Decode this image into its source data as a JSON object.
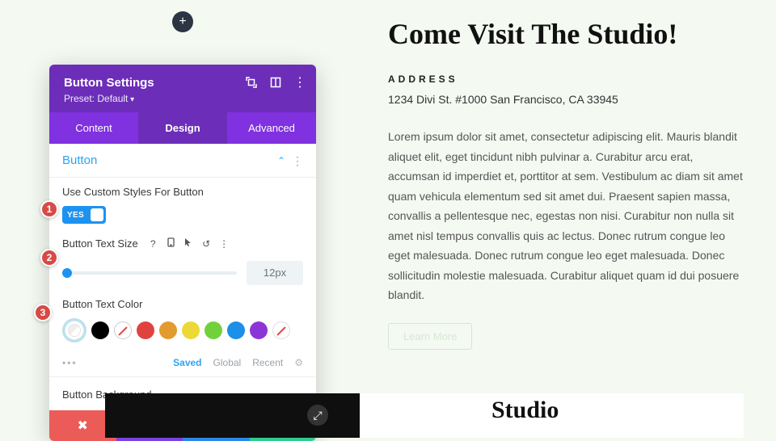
{
  "addButton": {
    "glyph": "+"
  },
  "panel": {
    "title": "Button Settings",
    "preset": "Preset: Default",
    "tabs": {
      "content": "Content",
      "design": "Design",
      "advanced": "Advanced"
    },
    "accordionTitle": "Button",
    "useCustomLabel": "Use Custom Styles For Button",
    "toggleYes": "YES",
    "textSizeLabel": "Button Text Size",
    "textSizeValue": "12px",
    "textColorLabel": "Button Text Color",
    "swatch": {
      "black": "#000000",
      "white": "#ffffff",
      "red": "#e0433f",
      "orange": "#e29b2f",
      "yellow": "#ecd836",
      "green": "#72d13b",
      "blue": "#1c8fe8",
      "purple": "#8c35d6"
    },
    "subrow": {
      "saved": "Saved",
      "global": "Global",
      "recent": "Recent"
    },
    "bgLabel": "Button Background"
  },
  "badges": {
    "b1": "1",
    "b2": "2",
    "b3": "3"
  },
  "right": {
    "headline": "Come Visit The Studio!",
    "addressLabel": "ADDRESS",
    "address": "1234 Divi St. #1000 San Francisco, CA 33945",
    "para": "Lorem ipsum dolor sit amet, consectetur adipiscing elit. Mauris blandit aliquet elit, eget tincidunt nibh pulvinar a. Curabitur arcu erat, accumsan id imperdiet et, porttitor at sem. Vestibulum ac diam sit amet quam vehicula elementum sed sit amet dui. Praesent sapien massa, convallis a pellentesque nec, egestas non nisi. Curabitur non nulla sit amet nisl tempus convallis quis ac lectus. Donec rutrum congue leo eget malesuada. Donec rutrum congue leo eget malesuada. Donec sollicitudin molestie malesuada. Curabitur aliquet quam id dui posuere blandit.",
    "ghostBtn": "Learn More"
  },
  "studio": {
    "title": "Studio"
  }
}
